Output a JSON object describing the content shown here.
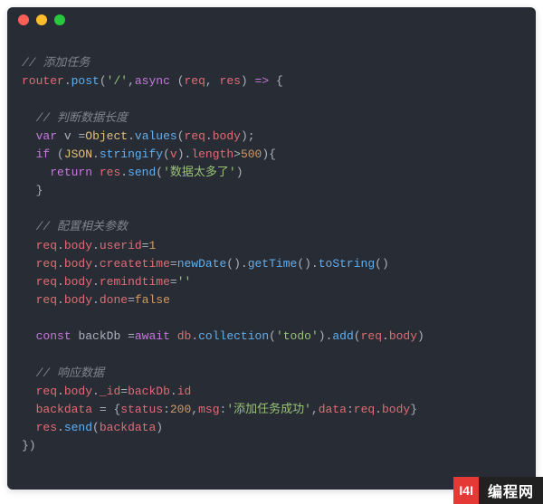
{
  "code": {
    "c1": "// 添加任务",
    "k_router": "router",
    "f_post": "post",
    "s_slash": "'/'",
    "k_async": "async",
    "p_req": "req",
    "p_res": "res",
    "c2": "// 判断数据长度",
    "k_var": "var",
    "v_v": "v",
    "cls_object": "Object",
    "f_values": "values",
    "p_reqbody": "req",
    "p_body": "body",
    "k_if": "if",
    "cls_json": "JSON",
    "f_stringify": "stringify",
    "p_length": "length",
    "n_500": "500",
    "k_return": "return",
    "f_send": "send",
    "s_toomuch": "'数据太多了'",
    "c3": "// 配置相关参数",
    "p_userid": "userid",
    "n_1": "1",
    "p_createtime": "createtime",
    "f_newdate": "newDate",
    "f_gettime": "getTime",
    "f_tostring": "toString",
    "p_remindtime": "remindtime",
    "s_empty": "''",
    "p_done": "done",
    "b_false": "false",
    "k_const": "const",
    "v_backdb": "backDb",
    "k_await": "await",
    "v_db": "db",
    "f_collection": "collection",
    "s_todo": "'todo'",
    "f_add": "add",
    "c4": "// 响应数据",
    "p_id": "_id",
    "p_id2": "id",
    "v_backdata": "backdata",
    "p_status": "status",
    "n_200": "200",
    "p_msg": "msg",
    "s_success": "'添加任务成功'",
    "p_data": "data"
  },
  "watermark": {
    "logo": "I4I",
    "text": "编程网"
  }
}
